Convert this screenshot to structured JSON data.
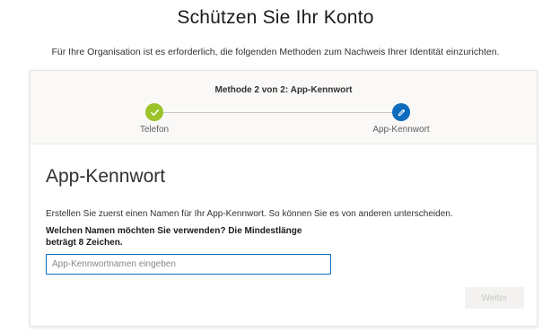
{
  "header": {
    "title": "Schützen Sie Ihr Konto",
    "subtitle": "Für Ihre Organisation ist es erforderlich, die folgenden Methoden zum Nachweis Ihrer Identität einzurichten."
  },
  "progress": {
    "step_label": "Methode 2 von 2: App-Kennwort",
    "steps": [
      {
        "label": "Telefon",
        "state": "completed",
        "icon": "checkmark-icon",
        "color": "#9bc42b"
      },
      {
        "label": "App-Kennwort",
        "state": "current",
        "icon": "pencil-icon",
        "color": "#0f6cbd"
      }
    ]
  },
  "section": {
    "title": "App-Kennwort",
    "description": "Erstellen Sie zuerst einen Namen für Ihr App-Kennwort. So können Sie es von anderen unterscheiden.",
    "question": "Welchen Namen möchten Sie verwenden? Die Mindestlänge beträgt 8 Zeichen.",
    "input": {
      "value": "",
      "placeholder": "App-Kennwortnamen eingeben"
    },
    "next_button": "Weiter"
  },
  "colors": {
    "accent": "#0f6cbd",
    "success": "#9bc42b"
  }
}
